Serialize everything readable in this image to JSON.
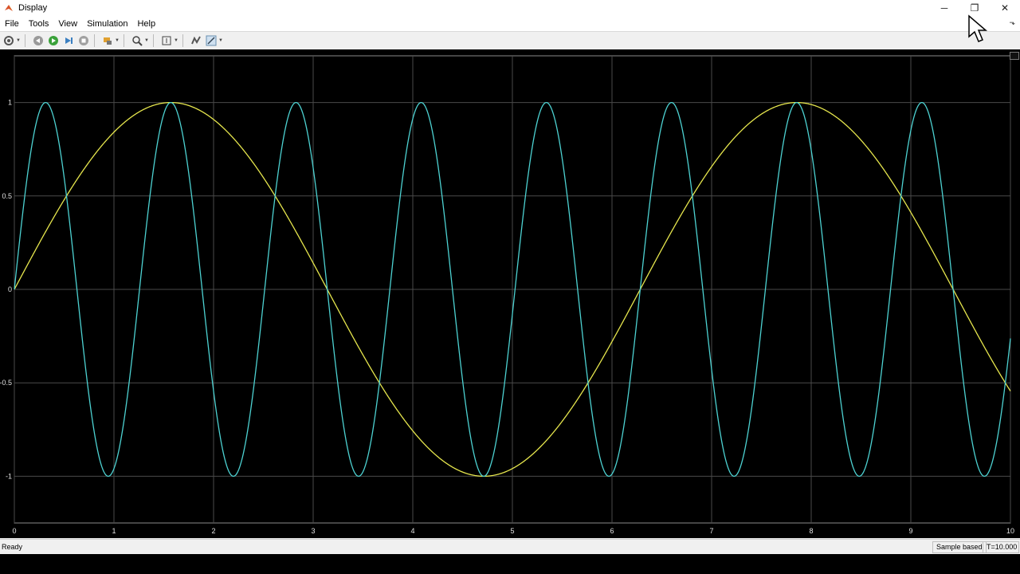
{
  "window": {
    "title": "Display",
    "controls": {
      "minimize": "─",
      "restore": "❐",
      "close": "✕"
    }
  },
  "menubar": {
    "items": [
      "File",
      "Tools",
      "View",
      "Simulation",
      "Help"
    ],
    "overflow": "⬎"
  },
  "toolbar": {
    "buttons": [
      "settings-icon",
      "step-back-icon",
      "run-icon",
      "step-forward-icon",
      "stop-icon",
      "highlight-icon",
      "zoom-icon",
      "scale-axes-icon",
      "triggers-icon",
      "measurements-icon"
    ]
  },
  "statusbar": {
    "status": "Ready",
    "mode": "Sample based",
    "time": "T=10.000"
  },
  "colors": {
    "background": "#000000",
    "grid": "#4a4a4a",
    "axis_text": "#e0e0e0",
    "series1": "#e6e64d",
    "series2": "#4dd2d2"
  },
  "chart_data": {
    "type": "line",
    "title": "",
    "xlabel": "",
    "ylabel": "",
    "xlim": [
      0,
      10
    ],
    "ylim": [
      -1.25,
      1.25
    ],
    "xticks": [
      0,
      1,
      2,
      3,
      4,
      5,
      6,
      7,
      8,
      9,
      10
    ],
    "yticks": [
      1,
      0.5,
      0,
      -0.5,
      -1
    ],
    "ytick_labels": [
      "1",
      "0.5",
      "0",
      "-0.5",
      "-1"
    ],
    "grid": true,
    "series": [
      {
        "function": "sin(t)",
        "amplitude": 1,
        "frequency_rad_per_s": 1,
        "color": "#e6e64d"
      },
      {
        "function": "sin(5t)",
        "amplitude": 1,
        "frequency_rad_per_s": 5,
        "color": "#4dd2d2"
      }
    ]
  }
}
